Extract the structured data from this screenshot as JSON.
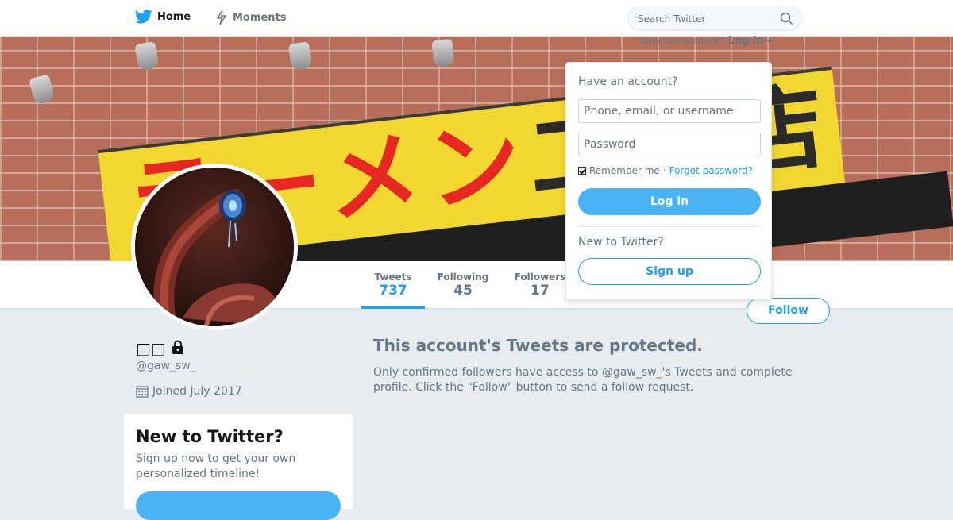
{
  "nav": {
    "home_label": "Home",
    "moments_label": "Moments",
    "search_placeholder": "Search Twitter"
  },
  "banner": {
    "sign_text_red": "ラーメン",
    "sign_text_dark": "二郎",
    "sign_text_tail": "店"
  },
  "profile": {
    "name": "□□",
    "screen_name": "@gaw_sw_",
    "joined": "Joined July 2017",
    "protected": true
  },
  "stats": [
    {
      "label": "Tweets",
      "value": "737"
    },
    {
      "label": "Following",
      "value": "45"
    },
    {
      "label": "Followers",
      "value": "17"
    }
  ],
  "follow_label": "Follow",
  "protected_message": {
    "title": "This account's Tweets are protected.",
    "body": "Only confirmed followers have access to @gaw_sw_'s Tweets and complete profile. Click the \"Follow\" button to send a follow request."
  },
  "signup_card": {
    "title": "New to Twitter?",
    "body": "Sign up now to get your own personalized timeline!"
  },
  "login": {
    "have_account": "Have an account?",
    "toggle_label": "Log in",
    "dropdown_title": "Have an account?",
    "username_placeholder": "Phone, email, or username",
    "password_placeholder": "Password",
    "remember_label": "Remember me",
    "separator": "·",
    "forgot_label": "Forgot password?",
    "login_button": "Log in",
    "new_to_twitter": "New to Twitter?",
    "signup_button": "Sign up"
  },
  "colors": {
    "accent": "#1da1f2",
    "button_fill": "#4ab3f4",
    "background": "#e6ecf0"
  },
  "icons": {
    "logo": "twitter-bird-icon",
    "moments": "lightning-icon",
    "search": "search-icon",
    "lock": "lock-icon",
    "calendar": "calendar-icon"
  }
}
